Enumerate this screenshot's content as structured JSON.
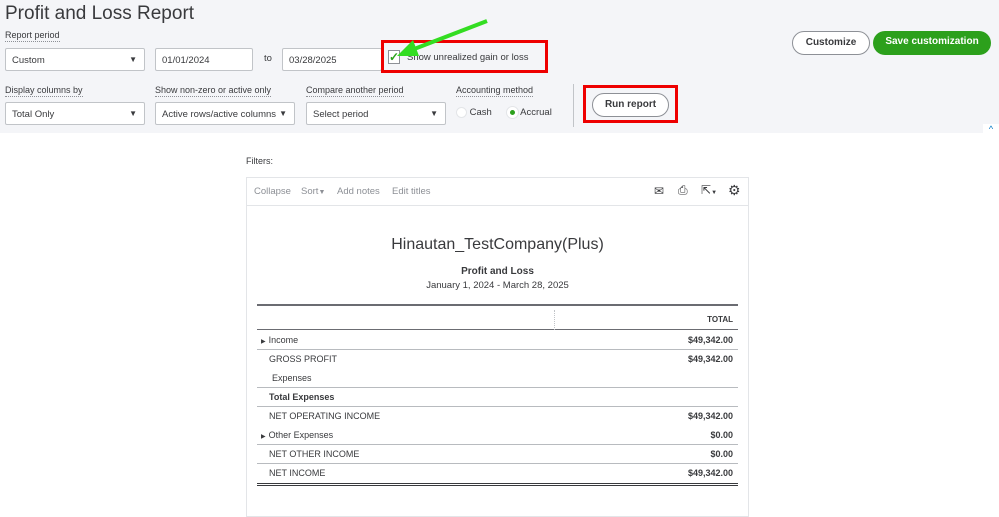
{
  "page_title": "Profit and Loss Report",
  "report_period": {
    "label": "Report period",
    "preset": "Custom",
    "start": "01/01/2024",
    "to": "to",
    "end": "03/28/2025"
  },
  "unrealized": {
    "label": "Show unrealized gain or loss",
    "checked": true
  },
  "display_columns": {
    "label": "Display columns by",
    "value": "Total Only"
  },
  "non_zero": {
    "label": "Show non-zero or active only",
    "value": "Active rows/active columns"
  },
  "compare": {
    "label": "Compare another period",
    "value": "Select period"
  },
  "accounting": {
    "label": "Accounting method",
    "options": [
      "Cash",
      "Accrual"
    ],
    "selected": "Accrual"
  },
  "buttons": {
    "run": "Run report",
    "customize": "Customize",
    "save": "Save customization"
  },
  "filters_label": "Filters:",
  "toolbar": {
    "collapse": "Collapse",
    "sort": "Sort",
    "add_notes": "Add notes",
    "edit_titles": "Edit titles"
  },
  "report": {
    "company": "Hinautan_TestCompany(Plus)",
    "name": "Profit and Loss",
    "range": "January 1, 2024 - March 28, 2025",
    "column": "TOTAL",
    "rows": [
      {
        "label": "Income",
        "amount": "$49,342.00"
      },
      {
        "label": "GROSS PROFIT",
        "amount": "$49,342.00"
      },
      {
        "label": "Expenses",
        "amount": ""
      },
      {
        "label": "Total Expenses",
        "amount": ""
      },
      {
        "label": "NET OPERATING INCOME",
        "amount": "$49,342.00"
      },
      {
        "label": "Other Expenses",
        "amount": "$0.00"
      },
      {
        "label": "NET OTHER INCOME",
        "amount": "$0.00"
      },
      {
        "label": "NET INCOME",
        "amount": "$49,342.00"
      }
    ]
  },
  "colors": {
    "accent_green": "#2ca01c",
    "highlight_red": "#e00000",
    "arrow_green": "#33dd22"
  }
}
